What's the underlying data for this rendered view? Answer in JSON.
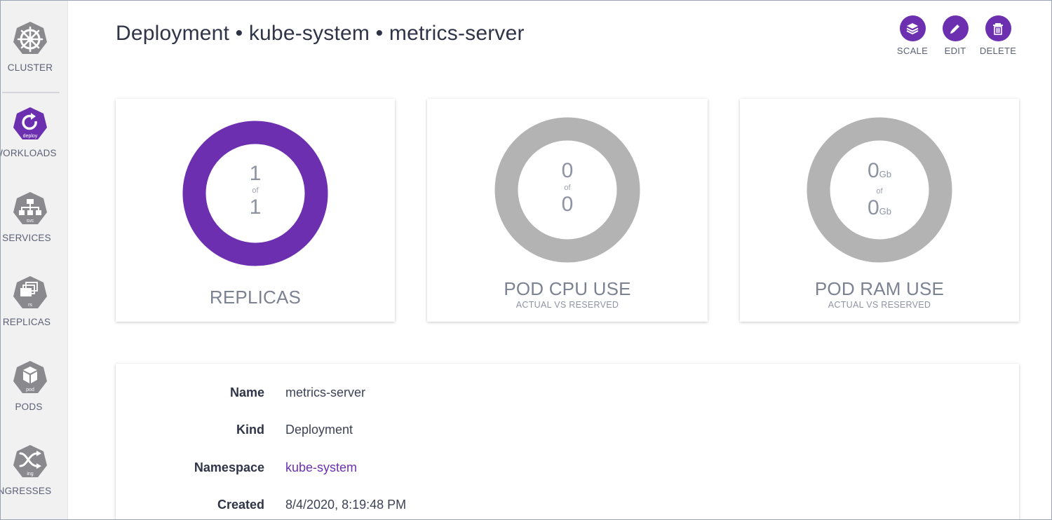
{
  "sidebar": {
    "items": [
      {
        "label": "CLUSTER",
        "icon": "helm-wheel-icon",
        "sub": ""
      },
      {
        "label": "WORKLOADS",
        "icon": "deploy-icon",
        "sub": "deploy"
      },
      {
        "label": "SERVICES",
        "icon": "svc-icon",
        "sub": "svc"
      },
      {
        "label": "REPLICAS",
        "icon": "rs-icon",
        "sub": "rs"
      },
      {
        "label": "PODS",
        "icon": "pod-icon",
        "sub": "pod"
      },
      {
        "label": "INGRESSES",
        "icon": "ing-icon",
        "sub": "ing"
      }
    ]
  },
  "header": {
    "title": "Deployment • kube-system • metrics-server"
  },
  "actions": {
    "scale": "SCALE",
    "edit": "EDIT",
    "delete": "DELETE"
  },
  "cards": {
    "replicas": {
      "value": "1",
      "of": "of",
      "total": "1",
      "title": "REPLICAS",
      "fill": 1.0
    },
    "cpu": {
      "value": "0",
      "of": "of",
      "total": "0",
      "title": "POD CPU USE",
      "subtitle": "ACTUAL VS RESERVED"
    },
    "ram": {
      "value": "0",
      "value_unit": "Gb",
      "of": "of",
      "total": "0",
      "total_unit": "Gb",
      "title": "POD RAM USE",
      "subtitle": "ACTUAL VS RESERVED"
    }
  },
  "details": {
    "name_label": "Name",
    "name_value": "metrics-server",
    "kind_label": "Kind",
    "kind_value": "Deployment",
    "namespace_label": "Namespace",
    "namespace_value": "kube-system",
    "created_label": "Created",
    "created_value": "8/4/2020, 8:19:48 PM"
  },
  "colors": {
    "accent": "#6b2fb0",
    "ring_gray": "#b3b3b3",
    "sidebar_bg": "#f1f1f2",
    "icon_gray": "#8a8a8e"
  }
}
